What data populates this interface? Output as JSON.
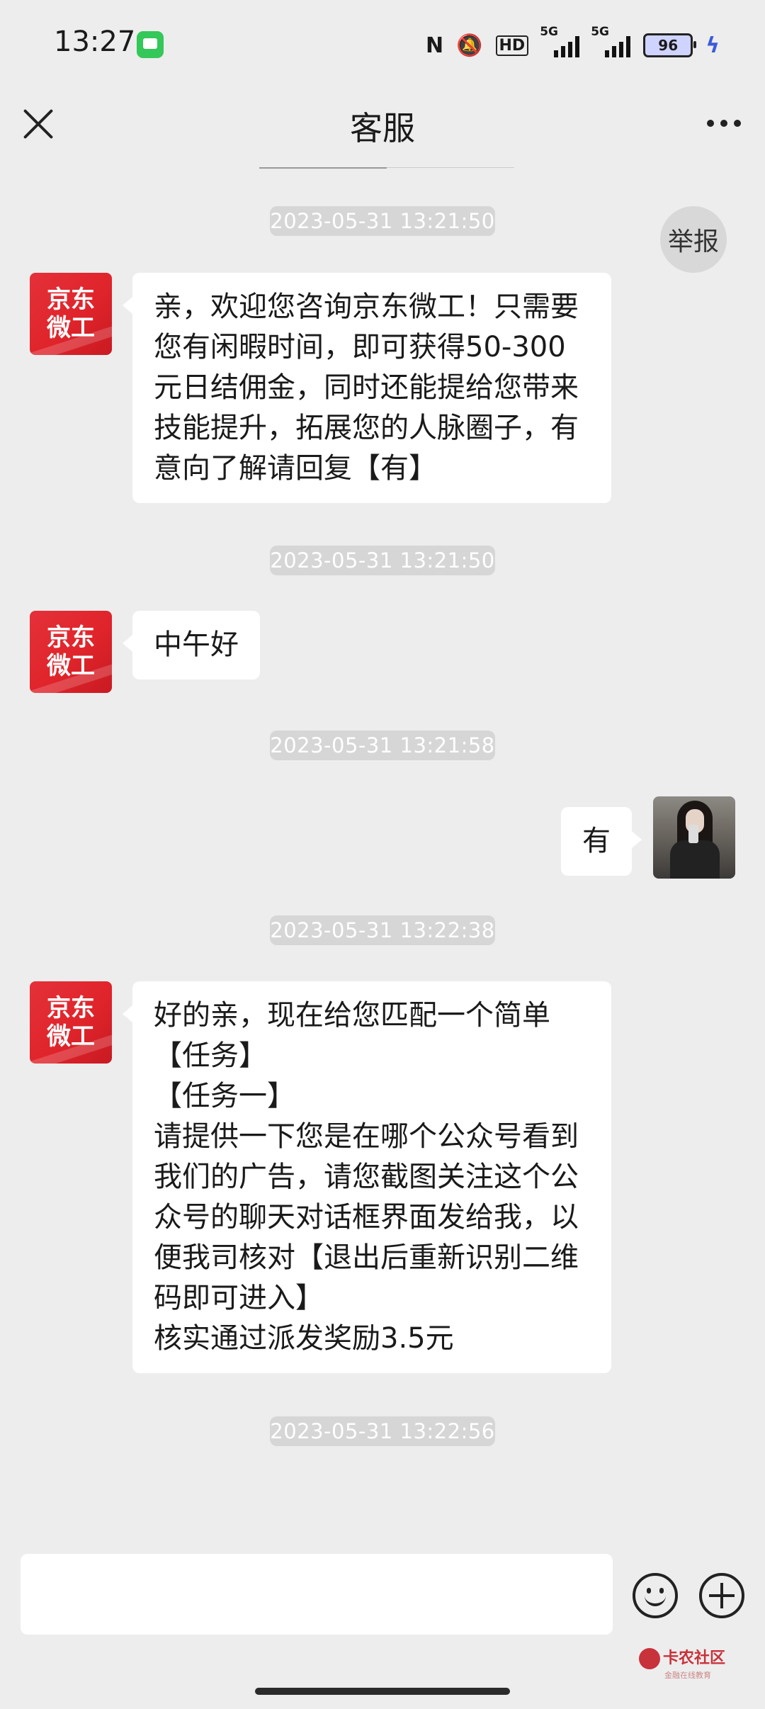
{
  "status_bar": {
    "time": "13:27",
    "nfc_label": "N",
    "hd_label": "HD",
    "sim1_label": "5G",
    "sim2_label": "5G",
    "battery": "96"
  },
  "header": {
    "title": "客服"
  },
  "report_label": "举报",
  "service_avatar": {
    "line1": "京东",
    "line2": "微工"
  },
  "messages": [
    {
      "timestamp": "2023-05-31 13:21:50",
      "text": "亲，欢迎您咨询京东微工！只需要您有闲暇时间，即可获得50-300元日结佣金，同时还能提给您带来技能提升，拓展您的人脉圈子，有意向了解请回复【有】"
    },
    {
      "timestamp": "2023-05-31 13:21:50",
      "text": "中午好"
    },
    {
      "timestamp": "2023-05-31 13:21:58",
      "text": "有"
    },
    {
      "timestamp": "2023-05-31 13:22:38",
      "text": "好的亲，现在给您匹配一个简单\n【任务】\n【任务一】\n请提供一下您是在哪个公众号看到我们的广告，请您截图关注这个公众号的聊天对话框界面发给我，以便我司核对【退出后重新识别二维码即可进入】\n核实通过派发奖励3.5元"
    },
    {
      "timestamp": "2023-05-31 13:22:56"
    }
  ],
  "input": {
    "placeholder": ""
  },
  "watermark": {
    "title": "卡农社区",
    "subtitle": "金融在线教育"
  },
  "colors": {
    "background": "#ededed",
    "bubble": "#ffffff",
    "timestamp_pill": "#d6d6d6",
    "service_avatar": "#e0242b"
  }
}
